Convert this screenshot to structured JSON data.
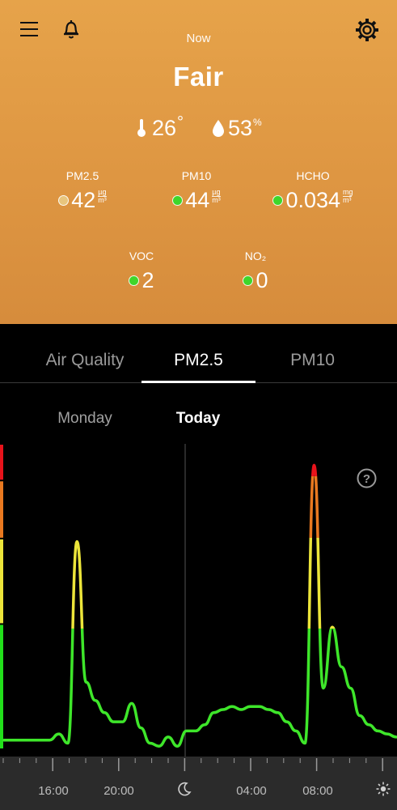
{
  "header": {
    "time_label": "Now",
    "status": "Fair",
    "temperature": {
      "value": "26",
      "unit": "°"
    },
    "humidity": {
      "value": "53",
      "unit": "%"
    }
  },
  "metrics": [
    {
      "label": "PM2.5",
      "value": "42",
      "unit_top": "µg",
      "unit_bottom": "m³",
      "dot_color": "#e8c57d"
    },
    {
      "label": "PM10",
      "value": "44",
      "unit_top": "µg",
      "unit_bottom": "m³",
      "dot_color": "#3ed62a"
    },
    {
      "label": "HCHO",
      "value": "0.034",
      "unit_top": "mg",
      "unit_bottom": "m³",
      "dot_color": "#3ed62a"
    },
    {
      "label": "VOC",
      "value": "2",
      "dot_color": "#3ed62a"
    },
    {
      "label": "NO₂",
      "value": "0",
      "dot_color": "#3ed62a"
    }
  ],
  "tabs": [
    "Air Quality",
    "PM2.5",
    "PM10"
  ],
  "active_tab": "PM2.5",
  "days": [
    "Monday",
    "Today"
  ],
  "active_day": "Today",
  "time_axis": {
    "labels": [
      "16:00",
      "20:00",
      "04:00",
      "08:00"
    ],
    "night_icon": "moon-icon",
    "day_icon": "sun-icon"
  },
  "colors": {
    "header_bg": "#e0993f",
    "good": "#22e01b",
    "moderate": "#ece53a",
    "unhealthy": "#e97920",
    "very_unhealthy": "#e8131b",
    "line": "#3ee62a"
  },
  "chart_data": {
    "type": "line",
    "series": [
      {
        "values": [
          3,
          3,
          3,
          3,
          3,
          3,
          5,
          2,
          68,
          22,
          16,
          12,
          9,
          9,
          15,
          7,
          2,
          1,
          4,
          1,
          6,
          6,
          8,
          12,
          13,
          14,
          13,
          14,
          14,
          13,
          12,
          9,
          6,
          2,
          93,
          20,
          40,
          27,
          20,
          11,
          8,
          6,
          5,
          4
        ]
      }
    ],
    "bands": [
      "good",
      "moderate",
      "unhealthy",
      "very_unhealthy"
    ]
  }
}
